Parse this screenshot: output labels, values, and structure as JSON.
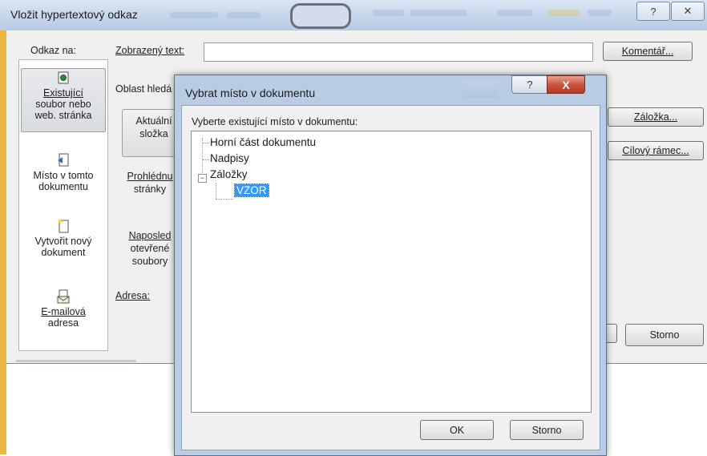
{
  "outer_dialog": {
    "title": "Vložit hypertextový odkaz",
    "help_glyph": "?",
    "close_glyph": "✕",
    "link_to_label": "Odkaz na:",
    "display_text_label": "Zobrazený text:",
    "display_text_value": "",
    "look_in_label": "Oblast hledá",
    "address_label": "Adresa:",
    "buttons": {
      "comment": "Komentář...",
      "bookmark": "Záložka...",
      "target_frame": "Cílový rámec...",
      "cancel": "Storno"
    },
    "sidebar": {
      "items": [
        {
          "line1": "Existující",
          "line2": "soubor nebo",
          "line3": "web. stránka",
          "icon": "web-page-icon"
        },
        {
          "line1": "Místo v tomto",
          "line2": "dokumentu",
          "icon": "place-in-document-icon"
        },
        {
          "line1": "Vytvořit nový",
          "line2": "dokument",
          "icon": "new-document-icon"
        },
        {
          "line1": "E-mailová",
          "line2": "adresa",
          "icon": "email-icon"
        }
      ]
    },
    "folder_buttons": {
      "current_folder": {
        "line1": "Aktuální",
        "line2": "složka"
      },
      "browsed_pages": {
        "line1": "Prohlédnu",
        "line2": "stránky"
      },
      "recent_files": {
        "line1": "Naposled",
        "line2": "otevřené",
        "line3": "soubory"
      }
    }
  },
  "modal_dialog": {
    "title": "Vybrat místo v dokumentu",
    "help_glyph": "?",
    "close_glyph": "X",
    "instruction": "Vyberte existující místo v dokumentu:",
    "tree": {
      "nodes": [
        {
          "label": "Horní část dokumentu"
        },
        {
          "label": "Nadpisy"
        },
        {
          "label": "Záložky",
          "expanded": true,
          "toggle_glyph": "−"
        },
        {
          "label": "VZOR",
          "selected": true
        }
      ]
    },
    "ok_label": "OK",
    "cancel_label": "Storno"
  },
  "colors": {
    "selection": "#3399ff",
    "close_button": "#c9503c",
    "window_frame": "#b8cce4",
    "left_accent": "#e8b840"
  }
}
